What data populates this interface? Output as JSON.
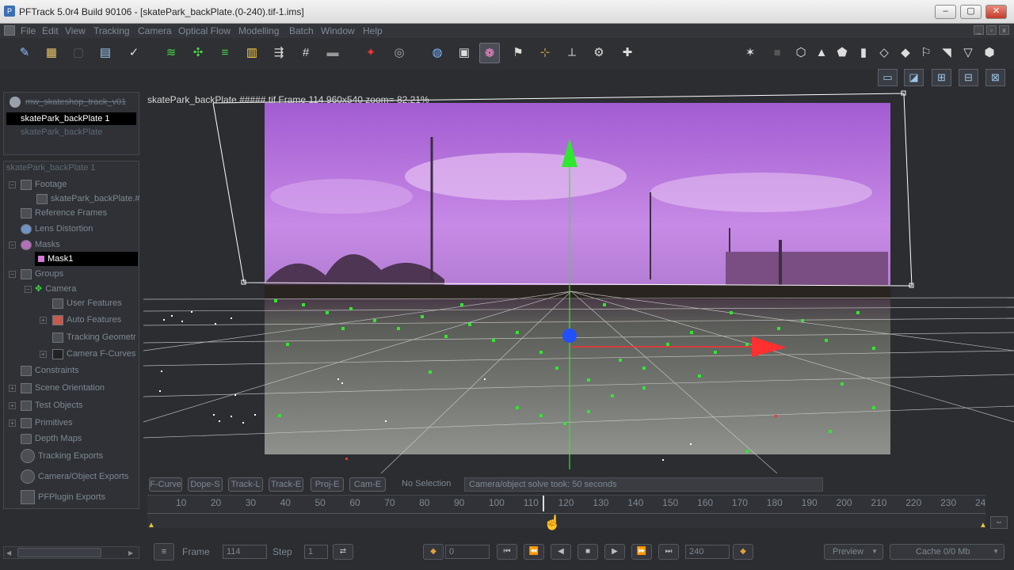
{
  "window": {
    "app_icon": "pftrack-app-icon",
    "title": "PFTrack 5.0r4 Build 90106 - [skatePark_backPlate.(0-240).tif-1.ims]",
    "controls": [
      "minimize-icon",
      "maximize-icon",
      "close-icon"
    ]
  },
  "menu": [
    "File",
    "Edit",
    "View",
    "Tracking",
    "Camera",
    "Optical Flow",
    "Modelling",
    "Batch",
    "Window",
    "Help"
  ],
  "clips": {
    "project": "mw_skateshop_track_v01",
    "items": [
      "skatePark_backPlate 1",
      "skatePark_backPlate"
    ]
  },
  "tree": {
    "root": "skatePark_backPlate 1",
    "items": [
      {
        "label": "Footage"
      },
      {
        "label": "skatePark_backPlate.#"
      },
      {
        "label": "Reference Frames"
      },
      {
        "label": "Lens Distortion"
      },
      {
        "label": "Masks"
      },
      {
        "label": "Mask1"
      },
      {
        "label": "Groups"
      },
      {
        "label": "Camera"
      },
      {
        "label": "User Features"
      },
      {
        "label": "Auto Features"
      },
      {
        "label": "Tracking Geometr"
      },
      {
        "label": "Camera F-Curves"
      },
      {
        "label": "Constraints"
      },
      {
        "label": "Scene Orientation"
      },
      {
        "label": "Test Objects"
      },
      {
        "label": "Primitives"
      },
      {
        "label": "Depth Maps"
      },
      {
        "label": "Tracking Exports"
      },
      {
        "label": "Camera/Object Exports"
      },
      {
        "label": "PFPlugin Exports"
      }
    ]
  },
  "viewport": {
    "info": "skatePark_backPlate.#####.tif  Frame 114  960x540  zoom= 82.21%"
  },
  "modes": [
    "F-Curve",
    "Dope-S",
    "Track-L",
    "Track-E",
    "Proj-E",
    "Cam-E"
  ],
  "status": {
    "selection": "No Selection",
    "message": "Camera/object solve took: 50 seconds"
  },
  "timeline": {
    "ticks": [
      "10",
      "20",
      "30",
      "40",
      "50",
      "60",
      "70",
      "80",
      "90",
      "100",
      "110",
      "120",
      "130",
      "140",
      "150",
      "160",
      "170",
      "180",
      "190",
      "200",
      "210",
      "220",
      "230",
      "24"
    ],
    "current_frame": 114,
    "start": 0,
    "end": 240
  },
  "playback": {
    "frame_label": "Frame",
    "frame_value": "114",
    "step_label": "Step",
    "step_value": "1",
    "in_value": "0",
    "out_value": "240",
    "preview_label": "Preview",
    "cache_label": "Cache 0/0 Mb"
  }
}
